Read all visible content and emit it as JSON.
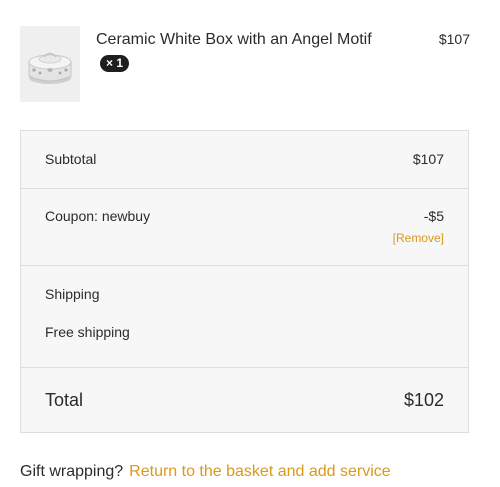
{
  "product": {
    "name": "Ceramic White Box with an Angel Motif",
    "quantity": "× 1",
    "price": "$107",
    "image_icon": "ceramic-box-image"
  },
  "totals": {
    "subtotal_label": "Subtotal",
    "subtotal_value": "$107",
    "coupon_label": "Coupon: newbuy",
    "coupon_value": "-$5",
    "coupon_remove": "[Remove]",
    "shipping_label": "Shipping",
    "shipping_method": "Free shipping",
    "total_label": "Total",
    "total_value": "$102"
  },
  "gift": {
    "question": "Gift wrapping?",
    "link": "Return to the basket and add service"
  },
  "colors": {
    "accent": "#d99a1b",
    "box_background": "#f7f7f7",
    "border": "#dedede",
    "badge": "#1f1f1f"
  }
}
